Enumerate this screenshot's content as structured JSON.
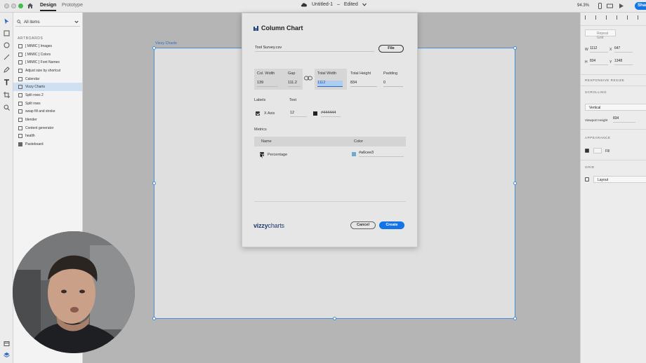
{
  "topbar": {
    "tab_design": "Design",
    "tab_prototype": "Prototype",
    "doc_name": "Untitled-1",
    "doc_status": "Edited",
    "zoom": "94.3%",
    "share_label": "Share"
  },
  "layers": {
    "search_label": "All items",
    "section_header": "ARTBOARDS",
    "items": [
      "[ MIMIC ] Images",
      "[ MIMIC ] Colors",
      "[ MIMIC ] Font Names",
      "Adjust size by shortcut",
      "Calendar",
      "Vizzy Charts",
      "Split rows 2",
      "Split rows",
      "swap fill and stroke",
      "blender",
      "Content generator",
      "health",
      "Pasteboard"
    ],
    "selected_index": 5
  },
  "artboard": {
    "label": "Vizzy Charts"
  },
  "dialog": {
    "title": "Column Chart",
    "file_value": "Tool Survey.csv",
    "file_button": "File",
    "dims": {
      "col_width_label": "Col. Width",
      "col_width_value": "139",
      "gap_label": "Gap",
      "gap_value": "111.2",
      "total_width_label": "Total Width",
      "total_width_value": "1112",
      "total_height_label": "Total Height",
      "total_height_value": "834",
      "padding_label": "Padding",
      "padding_value": "0"
    },
    "labels_header": "Labels",
    "text_header": "Text",
    "x_axis_label": "X Axis",
    "text_size": "12",
    "text_color": "#444444",
    "metrics_header": "Metrics",
    "metrics_col_name": "Name",
    "metrics_col_color": "Color",
    "metric_name": "Percentage",
    "metric_color": "#a6cee3",
    "brand_light": "vizzy",
    "brand_bold": "charts",
    "cancel_label": "Cancel",
    "create_label": "Create"
  },
  "properties": {
    "repeat_grid": "Repeat Grid",
    "w_label": "W",
    "w_value": "1112",
    "x_label": "X",
    "x_value": "647",
    "h_label": "H",
    "h_value": "834",
    "y_label": "Y",
    "y_value": "1348",
    "responsive_resize": "RESPONSIVE RESIZE",
    "scrolling": "SCROLLING",
    "scrolling_value": "Vertical",
    "viewport_height_label": "Viewport Height",
    "viewport_height_value": "834",
    "appearance": "APPEARANCE",
    "fill_label": "Fill",
    "grid": "GRID",
    "grid_value": "Layout"
  },
  "colors": {
    "accent": "#1473e6",
    "selection": "#4a8dd6",
    "metric_swatch": "#a6cee3",
    "text_swatch": "#444444"
  }
}
